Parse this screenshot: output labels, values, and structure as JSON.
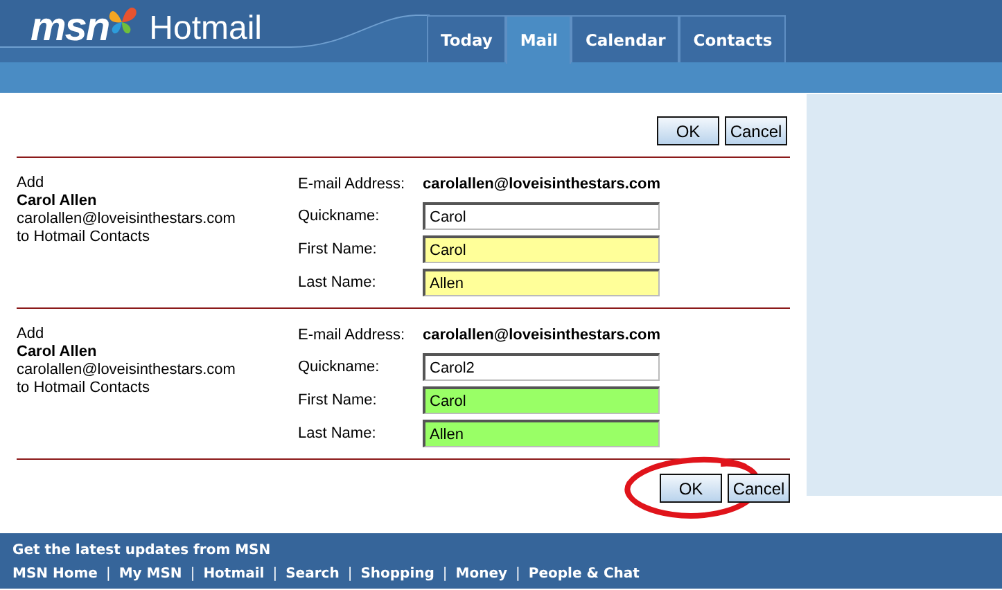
{
  "header": {
    "logo": "msn",
    "product": "Hotmail",
    "tabs": [
      {
        "label": "Today",
        "selected": false
      },
      {
        "label": "Mail",
        "selected": true
      },
      {
        "label": "Calendar",
        "selected": false
      },
      {
        "label": "Contacts",
        "selected": false
      }
    ]
  },
  "top_buttons": [
    {
      "label": "OK",
      "circled": false
    },
    {
      "label": "Cancel",
      "circled": false
    }
  ],
  "contacts": [
    {
      "intro": "Add",
      "name": "Carol Allen",
      "email": "carolallen@loveisinthestars.com",
      "outro": "to Hotmail Contacts",
      "fields": [
        {
          "kind": "text",
          "label": "E-mail Address:",
          "value": "carolallen@loveisinthestars.com"
        },
        {
          "kind": "input",
          "label": "Quickname:",
          "value": "Carol",
          "color": "#ffffff"
        },
        {
          "kind": "input",
          "label": "First Name:",
          "value": "Carol",
          "color": "#ffff99"
        },
        {
          "kind": "input",
          "label": "Last Name:",
          "value": "Allen",
          "color": "#ffff99"
        }
      ]
    },
    {
      "intro": "Add",
      "name": "Carol Allen",
      "email": "carolallen@loveisinthestars.com",
      "outro": "to Hotmail Contacts",
      "fields": [
        {
          "kind": "text",
          "label": "E-mail Address:",
          "value": "carolallen@loveisinthestars.com"
        },
        {
          "kind": "input",
          "label": "Quickname:",
          "value": "Carol2",
          "color": "#ffffff"
        },
        {
          "kind": "input",
          "label": "First Name:",
          "value": "Carol",
          "color": "#99ff66"
        },
        {
          "kind": "input",
          "label": "Last Name:",
          "value": "Allen",
          "color": "#99ff66"
        }
      ]
    }
  ],
  "bottom_buttons": [
    {
      "label": "OK",
      "circled": true
    },
    {
      "label": "Cancel",
      "circled": false
    }
  ],
  "footer": {
    "title": "Get the latest updates from MSN",
    "separator": "|",
    "links": [
      "MSN Home",
      "My MSN",
      "Hotmail",
      "Search",
      "Shopping",
      "Money",
      "People & Chat"
    ]
  }
}
